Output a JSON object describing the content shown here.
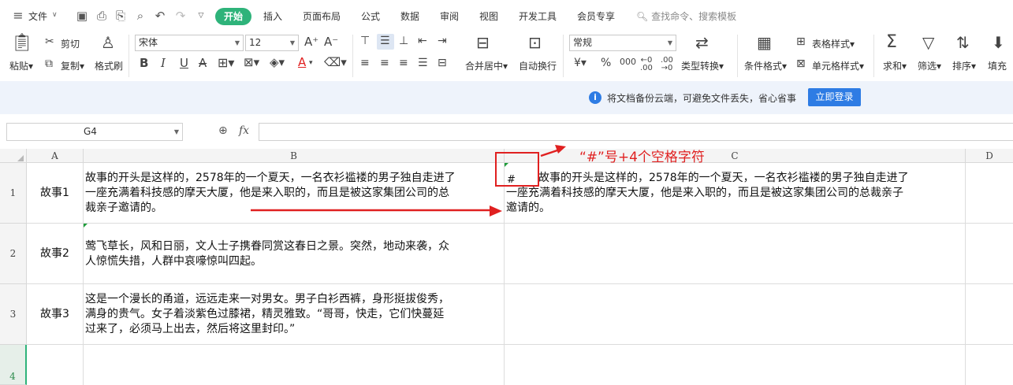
{
  "menubar": {
    "file_label": "文件",
    "tabs": [
      "开始",
      "插入",
      "页面布局",
      "公式",
      "数据",
      "审阅",
      "视图",
      "开发工具",
      "会员专享"
    ],
    "search_placeholder": "查找命令、搜索模板"
  },
  "ribbon": {
    "paste": "粘贴",
    "cut": "剪切",
    "copy": "复制",
    "format_painter": "格式刷",
    "font_name": "宋体",
    "font_size": "12",
    "merge_center": "合并居中",
    "wrap_text": "自动换行",
    "number_format": "常规",
    "type_convert": "类型转换",
    "conditional_format": "条件格式",
    "table_style": "表格样式",
    "cell_style": "单元格样式",
    "sum": "求和",
    "filter": "筛选",
    "sort": "排序",
    "fill": "填充"
  },
  "notice": {
    "text": "将文档备份云端，可避免文件丢失，省心省事",
    "button": "立即登录"
  },
  "formula_bar": {
    "cell_ref": "G4",
    "fx": "fx"
  },
  "grid": {
    "columns": [
      "A",
      "B",
      "C",
      "D"
    ],
    "rows": [
      "1",
      "2",
      "3",
      "4"
    ],
    "cells": {
      "A1": "故事1",
      "A2": "故事2",
      "A3": "故事3",
      "B1_lines": [
        "故事的开头是这样的，2578年的一个夏天，一名衣衫褴褛的男子独自走进了",
        "一座充满着科技感的摩天大厦，他是来入职的，而且是被这家集团公司的总",
        "裁亲子邀请的。"
      ],
      "B2_lines": [
        "莺飞草长，风和日丽，文人士子携眷同赏这春日之景。突然，地动来袭，众",
        "人惊慌失措，人群中哀嚎惊叫四起。"
      ],
      "B3_lines": [
        "这是一个漫长的甬道，远远走来一对男女。男子白衫西裤，身形挺拔俊秀，",
        "满身的贵气。女子着淡紫色过膝裙，精灵雅致。“哥哥，快走，它们快蔓延",
        "过来了，必须马上出去，然后将这里封印。”"
      ],
      "C1_prefix": "#",
      "C1_lines": [
        "故事的开头是这样的，2578年的一个夏天，一名衣衫褴褛的男子独自走进了",
        "一座充满着科技感的摩天大厦，他是来入职的，而且是被这家集团公司的总裁亲子",
        "邀请的。"
      ]
    }
  },
  "annotation": {
    "text": "“#”号+4个空格字符",
    "color": "#e02020"
  }
}
